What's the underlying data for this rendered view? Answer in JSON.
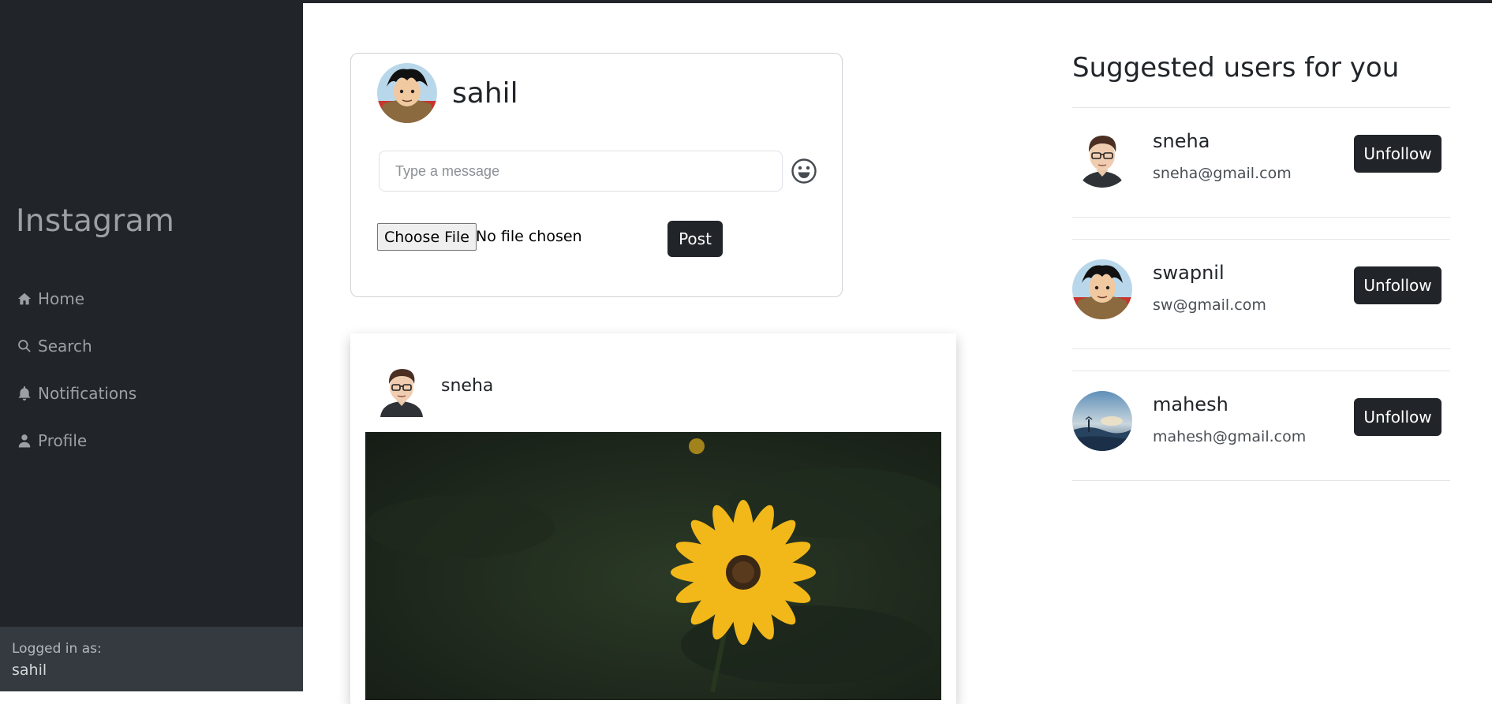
{
  "sidebar": {
    "brand": "Instagram",
    "items": [
      {
        "label": "Home",
        "icon": "home-icon"
      },
      {
        "label": "Search",
        "icon": "search-icon"
      },
      {
        "label": "Notifications",
        "icon": "bell-icon"
      },
      {
        "label": "Profile",
        "icon": "person-icon"
      }
    ],
    "logged_in_label": "Logged in as:",
    "logged_in_user": "sahil"
  },
  "composer": {
    "username": "sahil",
    "message_placeholder": "Type a message",
    "message_value": "",
    "choose_file_label": "Choose File",
    "file_status": "No file chosen",
    "post_label": "Post",
    "emoji_icon": "smiley-icon"
  },
  "feed": {
    "posts": [
      {
        "username": "sneha",
        "image_subject": "yellow flower"
      }
    ]
  },
  "suggestions": {
    "title": "Suggested users for you",
    "users": [
      {
        "name": "sneha",
        "email": "sneha@gmail.com",
        "action": "Unfollow"
      },
      {
        "name": "swapnil",
        "email": "sw@gmail.com",
        "action": "Unfollow"
      },
      {
        "name": "mahesh",
        "email": "mahesh@gmail.com",
        "action": "Unfollow"
      }
    ]
  },
  "colors": {
    "sidebar_bg": "#212529",
    "sidebar_footer_bg": "#343a40",
    "button_bg": "#212529",
    "muted_text": "#9ca0a5"
  }
}
